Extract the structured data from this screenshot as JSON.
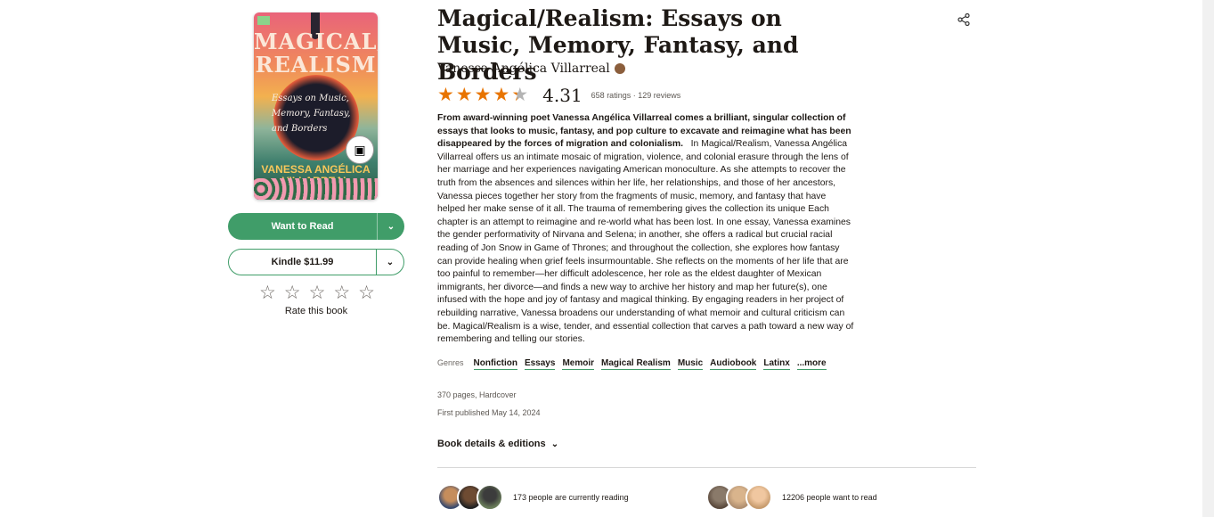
{
  "book": {
    "title": "Magical/Realism: Essays on Music, Memory, Fantasy, and Borders",
    "author": "Vanessa Angélica Villarreal",
    "cover": {
      "title": "MAGICAL/ REALISM",
      "subtitle": "Essays on Music, Memory, Fantasy, and Borders",
      "author": "VANESSA ANGÉLICA VILLARREAL"
    },
    "rating": 4.31,
    "rating_display": "4.31",
    "ratings_text": "658 ratings · 129 reviews",
    "description_bold": "From award-winning poet Vanessa Angélica Villarreal comes a brilliant, singular collection of essays that looks to music, fantasy, and pop culture to excavate and reimagine what has been disappeared by the forces of migration and colonialism.",
    "description_body": "In Magical/Realism, Vanessa Angélica Villarreal offers us an intimate mosaic of migration, violence, and colonial erasure through the lens of her marriage and her experiences navigating American monoculture. As she attempts to recover the truth from the absences and silences within her life, her relationships, and those of her ancestors, Vanessa pieces together her story from the fragments of music, memory, and fantasy that have helped her make sense of it all.   The trauma of remembering gives the collection its unique Each chapter is an attempt to reimagine and re-world what has been lost. In one essay, Vanessa examines the gender performativity of Nirvana and Selena; in another, she offers a radical but crucial racial reading of Jon Snow in Game of Thrones; and throughout the collection, she explores how fantasy can provide healing when grief feels insurmountable. She reflects on the moments of her life that are too painful to remember—her difficult adolescence, her role as the eldest daughter of Mexican immigrants, her divorce—and finds a new way to archive her history and map her future(s), one infused with the hope and joy of fantasy and magical thinking.   By engaging readers in her project of rebuilding narrative, Vanessa broadens our understanding of what memoir and cultural criticism can be. Magical/Realism is a wise, tender, and essential collection that carves a path toward a new way of remembering and telling our stories.",
    "genres_label": "Genres",
    "genres": [
      "Nonfiction",
      "Essays",
      "Memoir",
      "Magical Realism",
      "Music",
      "Audiobook",
      "Latinx"
    ],
    "genres_more": "...more",
    "pages_format": "370 pages, Hardcover",
    "first_published": "First published May 14, 2024",
    "details_link": "Book details & editions"
  },
  "actions": {
    "want_to_read": "Want to Read",
    "kindle": "Kindle $11.99",
    "rate_label": "Rate this book",
    "rate_stars": [
      "☆",
      "☆",
      "☆",
      "☆",
      "☆"
    ]
  },
  "social": {
    "currently_reading": "173 people are currently reading",
    "want_to_read": "12206 people want to read"
  },
  "colors": {
    "accent_green": "#409d69",
    "star_orange": "#e87400"
  }
}
